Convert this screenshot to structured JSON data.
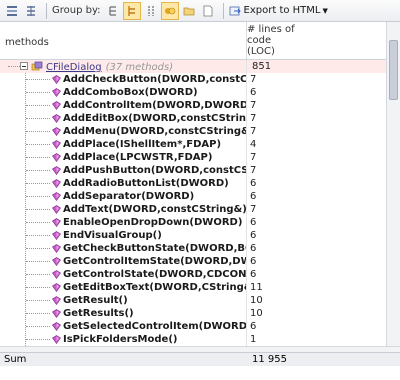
{
  "toolbar": {
    "group_by_label": "Group by:",
    "export_label": "Export to HTML",
    "accent_pressed": "#fde8a8"
  },
  "header": {
    "methods_label": "methods",
    "loc_label_line1": "# lines of",
    "loc_label_line2": "code",
    "loc_label_line3": "(LOC)"
  },
  "tree": {
    "root": {
      "name": "CFileDialog",
      "count": "(37 methods)",
      "value": "851",
      "icon": "class-icon"
    },
    "methods": [
      {
        "name": "AddCheckButton(DWORD,constCString&,B",
        "value": "7"
      },
      {
        "name": "AddComboBox(DWORD)",
        "value": "6"
      },
      {
        "name": "AddControlItem(DWORD,DWORD,constCS",
        "value": "7"
      },
      {
        "name": "AddEditBox(DWORD,constCString&)",
        "value": "7"
      },
      {
        "name": "AddMenu(DWORD,constCString&)",
        "value": "7"
      },
      {
        "name": "AddPlace(IShellItem*,FDAP)",
        "value": "4"
      },
      {
        "name": "AddPlace(LPCWSTR,FDAP)",
        "value": "7"
      },
      {
        "name": "AddPushButton(DWORD,constCString&)",
        "value": "7"
      },
      {
        "name": "AddRadioButtonList(DWORD)",
        "value": "6"
      },
      {
        "name": "AddSeparator(DWORD)",
        "value": "6"
      },
      {
        "name": "AddText(DWORD,constCString&)",
        "value": "7"
      },
      {
        "name": "EnableOpenDropDown(DWORD)",
        "value": "6"
      },
      {
        "name": "EndVisualGroup()",
        "value": "6"
      },
      {
        "name": "GetCheckButtonState(DWORD,BOOL&)",
        "value": "6"
      },
      {
        "name": "GetControlItemState(DWORD,DWORD,CD",
        "value": "6"
      },
      {
        "name": "GetControlState(DWORD,CDCONTROLST",
        "value": "6"
      },
      {
        "name": "GetEditBoxText(DWORD,CString&)",
        "value": "11"
      },
      {
        "name": "GetResult()",
        "value": "10"
      },
      {
        "name": "GetResults()",
        "value": "10"
      },
      {
        "name": "GetSelectedControlItem(DWORD,DWORD&",
        "value": "6"
      },
      {
        "name": "IsPickFoldersMode()",
        "value": "1"
      }
    ]
  },
  "footer": {
    "sum_label": "Sum",
    "sum_value": "11 955"
  }
}
